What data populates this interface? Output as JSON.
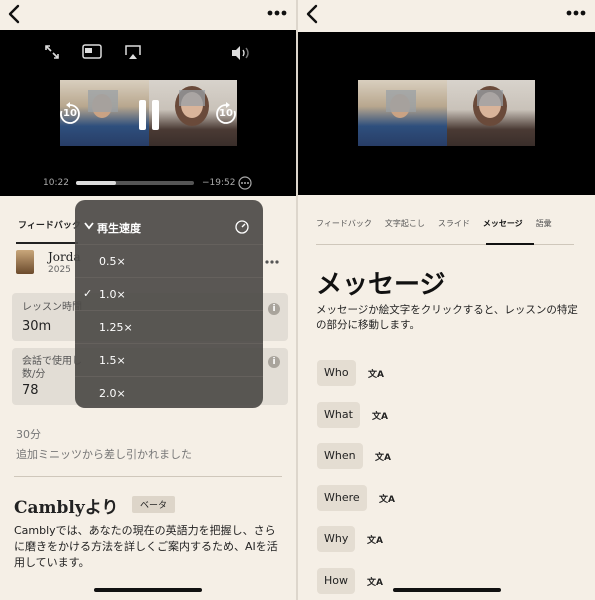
{
  "left": {
    "video": {
      "elapsed": "10:22",
      "remaining": "−19:52",
      "progress": 0.34,
      "skip_back": "10",
      "skip_forward": "10"
    },
    "tabs": {
      "feedback": "フィードバック"
    },
    "user": {
      "name": "Jorda",
      "date": "2025"
    },
    "cards": {
      "lesson_time_label": "レッスン時間",
      "lesson_time_value": "30m",
      "words_label_line1": "会話で使用し",
      "words_label_line2": "数/分",
      "words_value": "78"
    },
    "minutes_deducted": "30分",
    "deducted_note": "追加ミニッツから差し引かれました",
    "from_cambly_title": "Camblyより",
    "beta_badge": "ベータ",
    "from_cambly_text": "Camblyでは、あなたの現在の英語力を把握し、さらに磨きをかける方法を詳しくご案内するため、AIを活用しています。",
    "speed_menu": {
      "title": "再生速度",
      "options": [
        "0.5×",
        "1.0×",
        "1.25×",
        "1.5×",
        "2.0×"
      ],
      "selected": "1.0×"
    }
  },
  "right": {
    "tabs": [
      "フィードバック",
      "文字起こし",
      "スライド",
      "メッセージ",
      "語彙"
    ],
    "active_tab": "メッセージ",
    "title": "メッセージ",
    "description": "メッセージか絵文字をクリックすると、レッスンの特定の部分に移動します。",
    "messages": [
      "Who",
      "What",
      "When",
      "Where",
      "Why",
      "How"
    ]
  }
}
